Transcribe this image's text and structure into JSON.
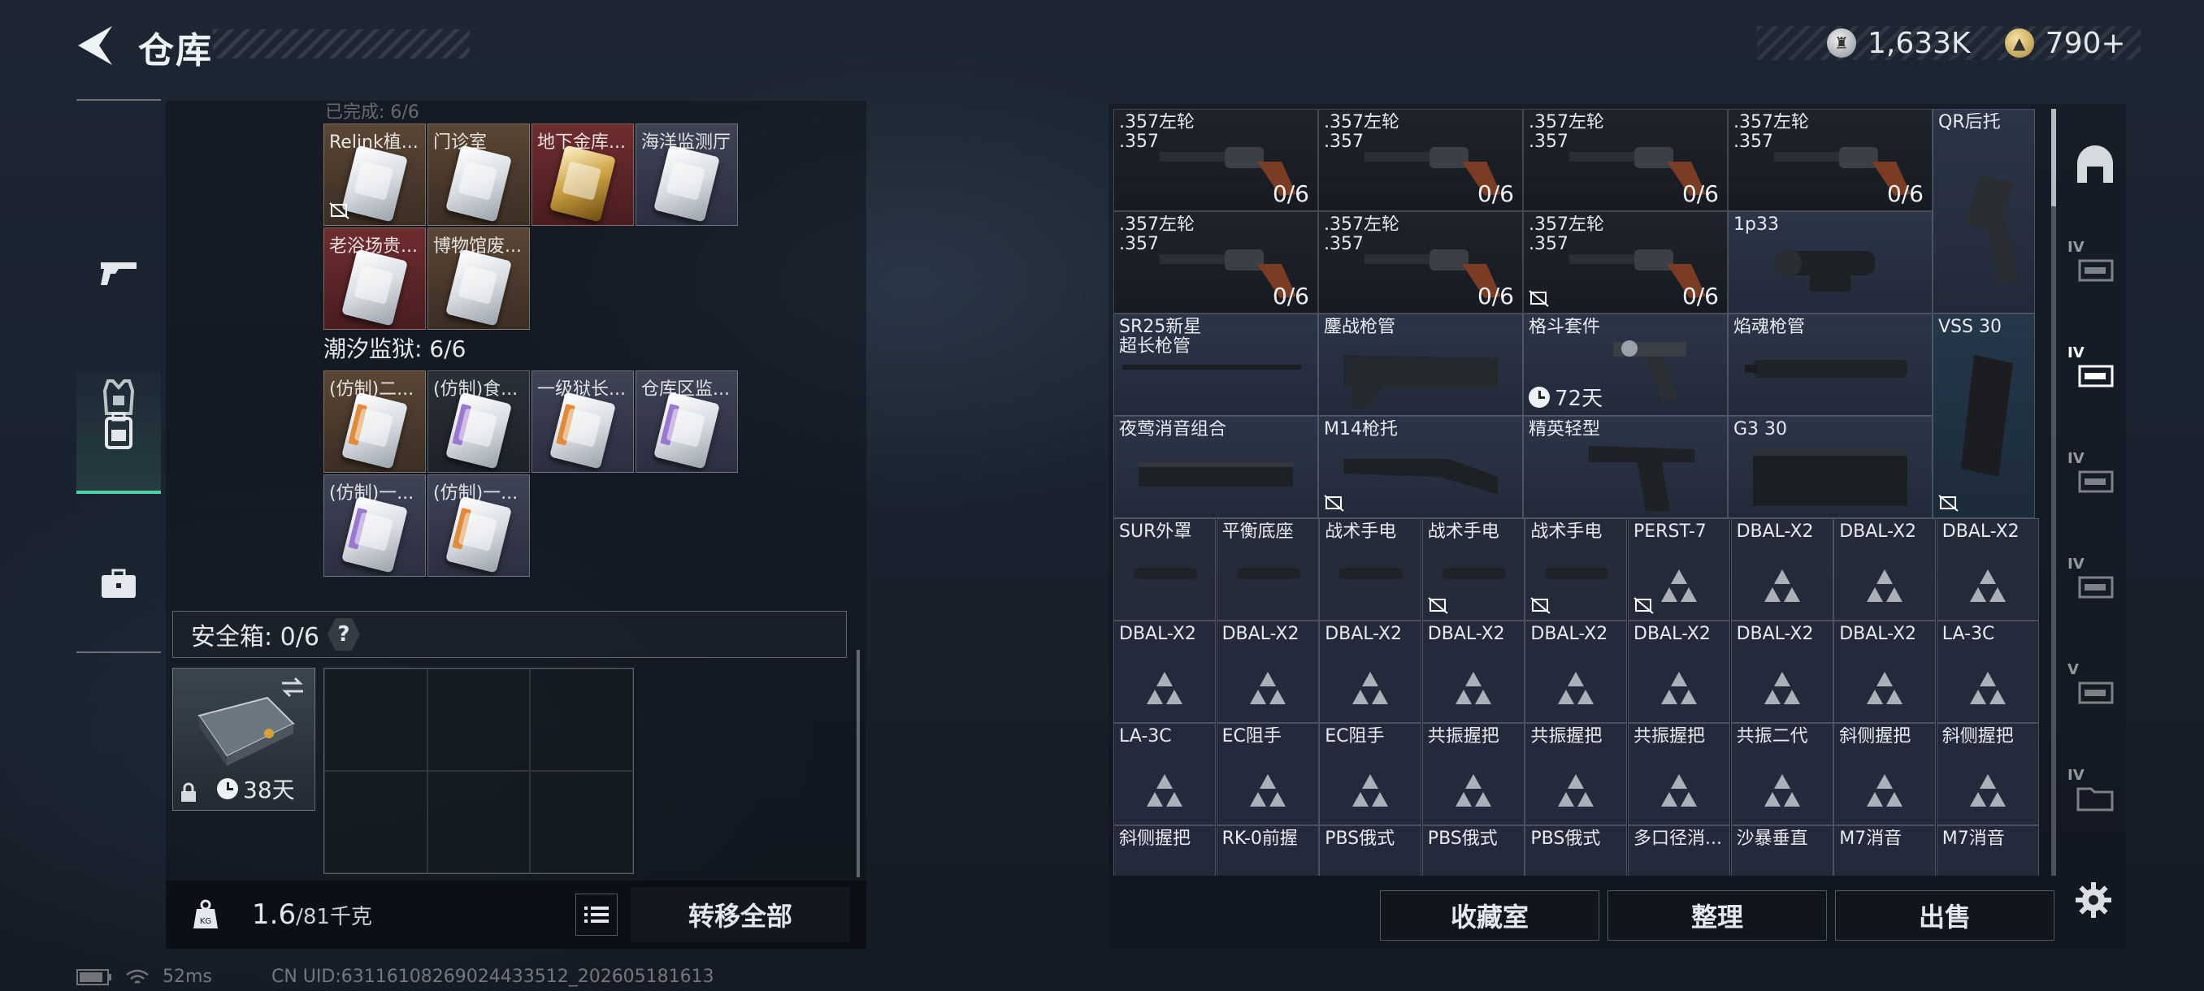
{
  "header": {
    "title": "仓库"
  },
  "currency": {
    "silver": "1,633K",
    "gold": "790+"
  },
  "left_nav": {
    "items": [
      "weapons",
      "equipment",
      "backpack",
      "toolbox"
    ],
    "active": 2
  },
  "stash": {
    "faded_header": "已完成: 6/6",
    "row1": [
      "Relink植...",
      "门诊室",
      "地下金库...",
      "海洋监测厅"
    ],
    "row2": [
      "老浴场贵...",
      "博物馆废..."
    ],
    "section_title": "潮汐监狱: 6/6",
    "row3": [
      "(仿制)二...",
      "(仿制)食...",
      "一级狱长...",
      "仓库区监..."
    ],
    "row4": [
      "(仿制)一...",
      "(仿制)一..."
    ]
  },
  "safebox": {
    "label": "安全箱: 0/6",
    "help": "?",
    "days": "38天"
  },
  "footer": {
    "weight": "1.6",
    "weight_max": "/81千克",
    "transfer_label": "转移全部"
  },
  "status": {
    "ping": "52ms",
    "uid": "CN UID:63116108269024433512_202605181613"
  },
  "grid": {
    "revolvers": [
      {
        "name": ".357左轮\n.357",
        "count": "0/6"
      },
      {
        "name": ".357左轮\n.357",
        "count": "0/6"
      },
      {
        "name": ".357左轮\n.357",
        "count": "0/6"
      },
      {
        "name": ".357左轮\n.357",
        "count": "0/6"
      },
      {
        "name": ".357左轮\n.357",
        "count": "0/6"
      },
      {
        "name": ".357左轮\n.357",
        "count": "0/6"
      },
      {
        "name": ".357左轮\n.357",
        "count": "0/6"
      }
    ],
    "qr_stock": "QR后托",
    "scope": "1p33",
    "row3": {
      "a": "SR25新星\n超长枪管",
      "b": "鏖战枪管",
      "c": "格斗套件",
      "c_timer": "72天",
      "d": "焰魂枪管",
      "e": "VSS 30"
    },
    "row4": {
      "a": "夜莺消音组合",
      "b": "M14枪托",
      "c": "精英轻型",
      "d": "G3 30"
    },
    "row5": [
      "SUR外罩",
      "平衡底座",
      "战术手电",
      "战术手电",
      "战术手电",
      "PERST-7",
      "DBAL-X2",
      "DBAL-X2",
      "DBAL-X2"
    ],
    "row6": [
      "DBAL-X2",
      "DBAL-X2",
      "DBAL-X2",
      "DBAL-X2",
      "DBAL-X2",
      "DBAL-X2",
      "DBAL-X2",
      "DBAL-X2",
      "LA-3C"
    ],
    "row7": [
      "LA-3C",
      "EC阻手",
      "EC阻手",
      "共振握把",
      "共振握把",
      "共振握把",
      "共振二代",
      "斜侧握把",
      "斜侧握把"
    ],
    "row8": [
      "斜侧握把",
      "RK-0前握",
      "PBS俄式",
      "PBS俄式",
      "PBS俄式",
      "多口径消...",
      "沙暴垂直",
      "M7消音",
      "M7消音"
    ]
  },
  "actions": {
    "collection": "收藏室",
    "sort": "整理",
    "sell": "出售"
  },
  "colors": {
    "accent": "#4fd1a3"
  }
}
